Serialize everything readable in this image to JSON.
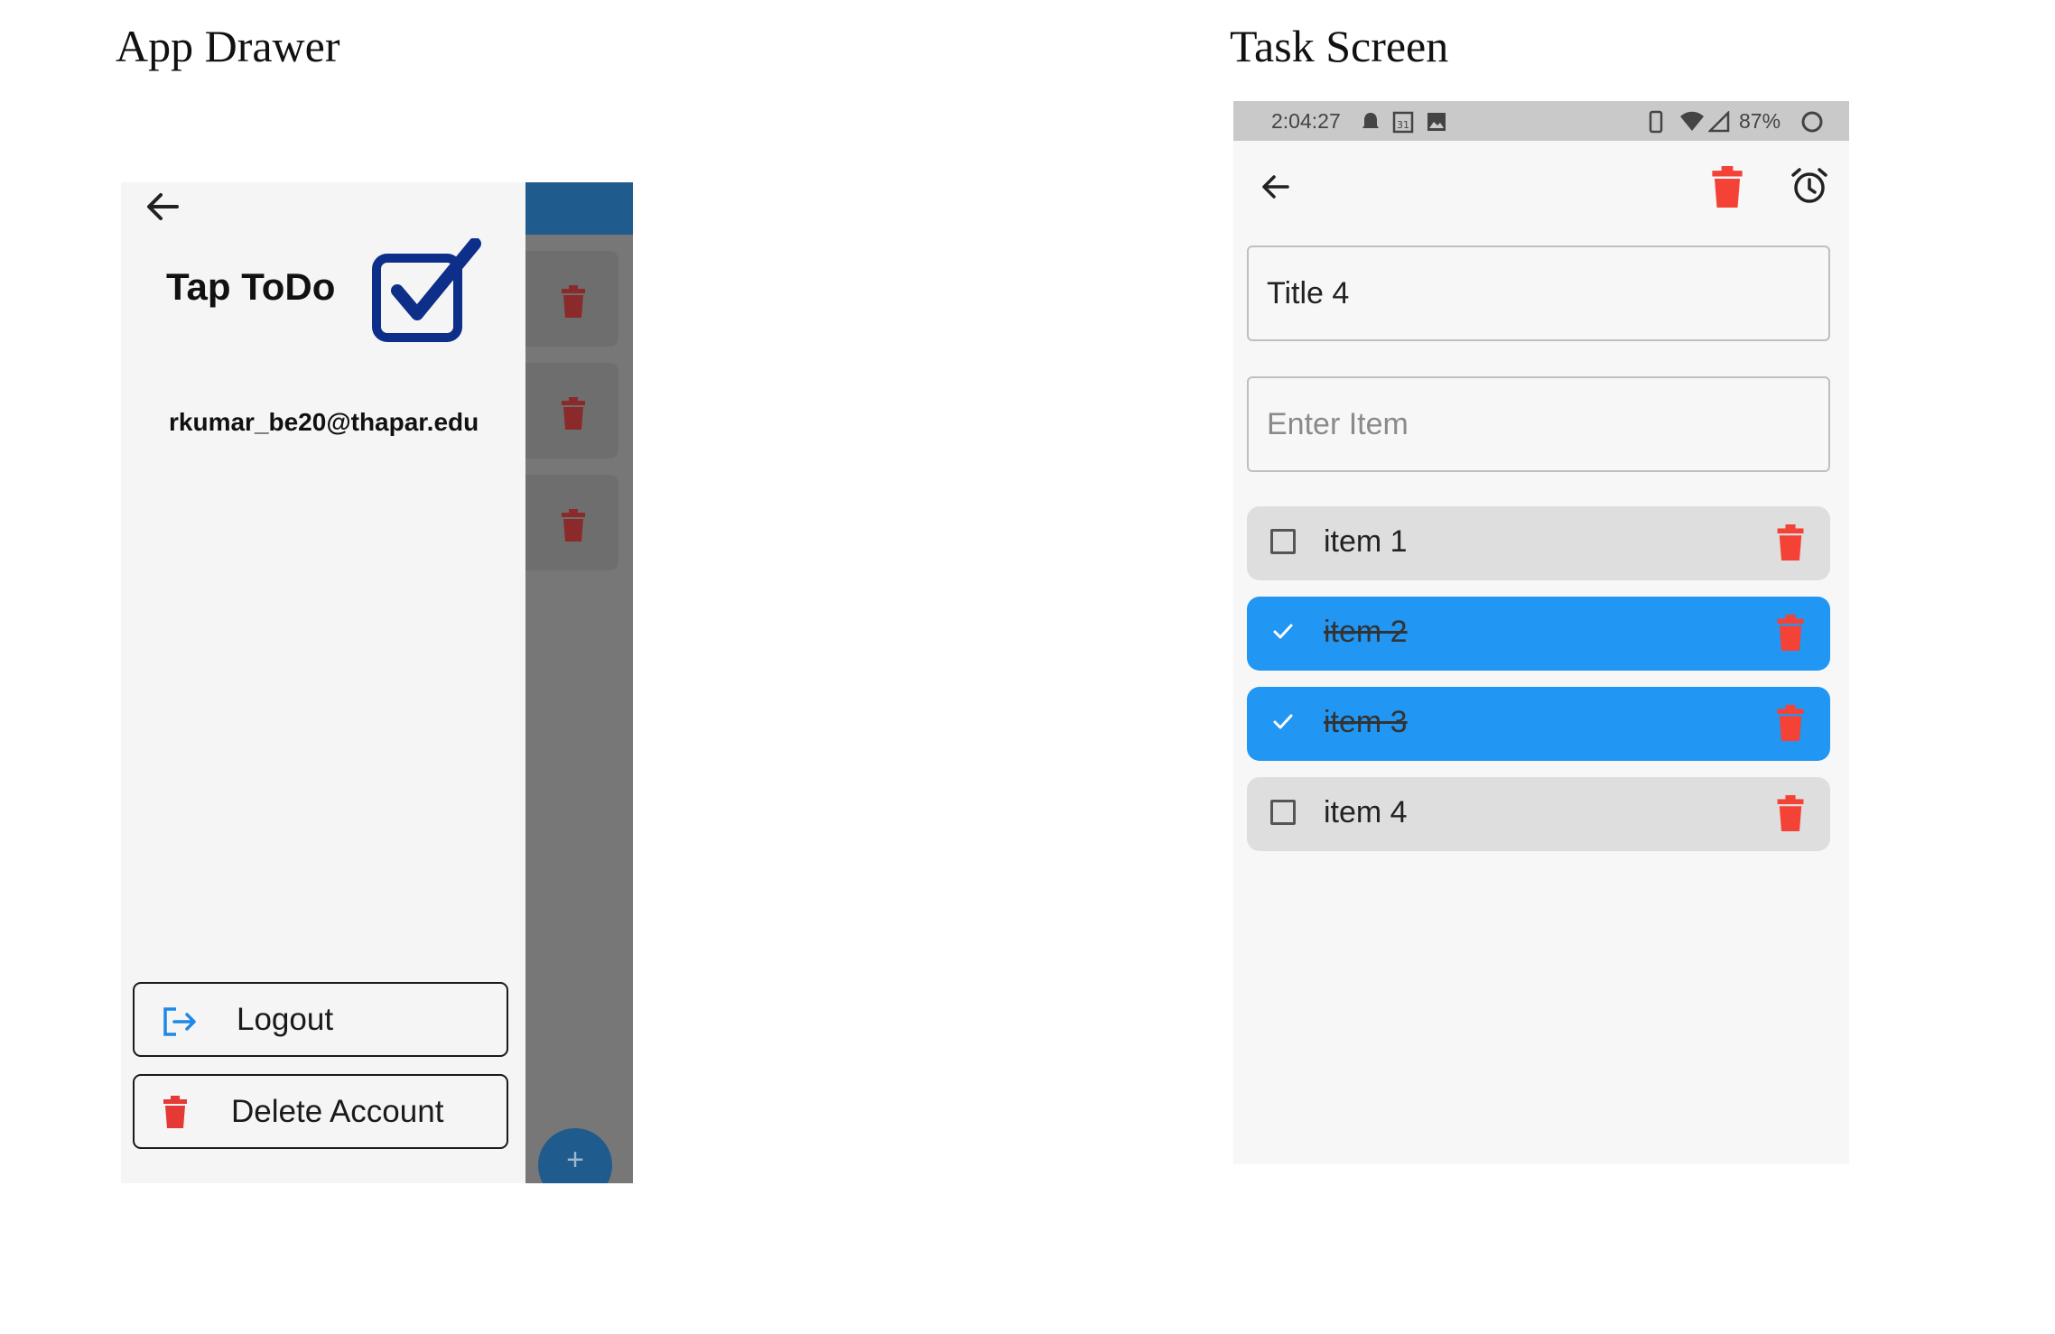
{
  "captions": {
    "left": "App Drawer",
    "right": "Task Screen"
  },
  "drawer": {
    "app_title": "Tap ToDo",
    "user_email": "rkumar_be20@thapar.edu",
    "logout_label": "Logout",
    "delete_account_label": "Delete Account",
    "fab_label": "+",
    "colors": {
      "logo_blue": "#0d2f8a",
      "scrim": "#777777",
      "app_bar": "#1f5b8d",
      "delete_red": "#e53935"
    }
  },
  "task_screen": {
    "status_bar": {
      "time": "2:04:27",
      "battery": "87%"
    },
    "title_value": "Title 4",
    "item_placeholder": "Enter Item",
    "items": [
      {
        "label": "item 1",
        "checked": false
      },
      {
        "label": "item 2",
        "checked": true
      },
      {
        "label": "item 3",
        "checked": true
      },
      {
        "label": "item 4",
        "checked": false
      }
    ],
    "colors": {
      "checked_bg": "#2196f3",
      "unchecked_bg": "#dedede",
      "delete_red": "#f44336"
    }
  }
}
